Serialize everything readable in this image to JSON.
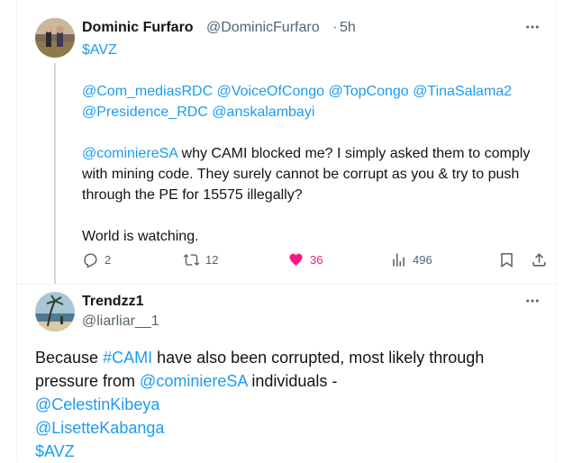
{
  "tweet1": {
    "display_name": "Dominic Furfaro",
    "handle": "@DominicFurfaro",
    "separator": "·",
    "time": "5h",
    "lines": {
      "l1": "$AVZ",
      "l2": [
        "@Com_mediasRDC",
        "@VoiceOfCongo",
        "@TopCongo",
        "@TinaSalama2"
      ],
      "l3": [
        "@Presidence_RDC",
        "@anskalambayi"
      ],
      "l4_mention": "@cominiereSA",
      "l4_text": " why CAMI blocked me? I simply asked them to comply with mining code. They surely cannot be corrupt as you & try to push through the PE for 15575 illegally?",
      "l5": "World is watching."
    },
    "stats": {
      "replies": "2",
      "reposts": "12",
      "likes": "36",
      "views": "496"
    }
  },
  "tweet2": {
    "display_name": "Trendzz1",
    "handle": "@liarliar__1",
    "lines": {
      "part1": "Because ",
      "hashtag": "#CAMI",
      "part2": " have also been corrupted, most likely through pressure from ",
      "mention1": "@cominiereSA",
      "part3": " individuals -",
      "mention2": "@CelestinKibeya",
      "mention3": "@LisetteKabanga",
      "cashtag": "$AVZ"
    }
  },
  "icons": {
    "reply": "reply-icon",
    "repost": "repost-icon",
    "like": "heart-icon",
    "views": "views-icon",
    "bookmark": "bookmark-icon",
    "share": "share-icon",
    "more": "more-icon"
  },
  "colors": {
    "link": "#1d9bf0",
    "text": "#0f1419",
    "secondary": "#536471",
    "like": "#f91880",
    "thread_line": "#cfd9de"
  }
}
